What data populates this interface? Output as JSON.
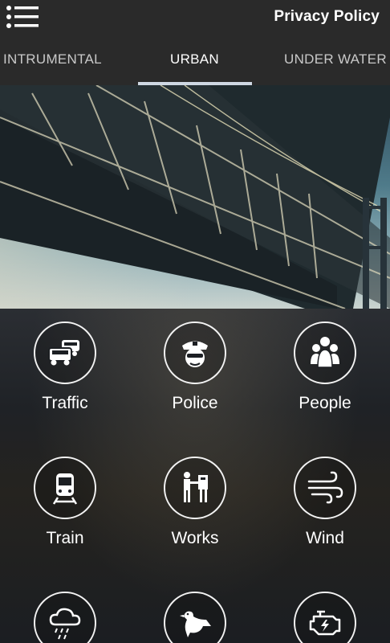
{
  "topbar": {
    "privacy_label": "Privacy Policy",
    "menu_icon": "list-menu-icon"
  },
  "tabs": [
    {
      "label": "INTRUMENTAL",
      "active": false
    },
    {
      "label": "URBAN",
      "active": true
    },
    {
      "label": "UNDER WATER",
      "active": false
    }
  ],
  "hero": {
    "image": "bridge-photo"
  },
  "sounds": [
    {
      "label": "Traffic",
      "icon": "cars-icon"
    },
    {
      "label": "Police",
      "icon": "police-officer-icon"
    },
    {
      "label": "People",
      "icon": "people-group-icon"
    },
    {
      "label": "Train",
      "icon": "train-icon"
    },
    {
      "label": "Works",
      "icon": "construction-worker-icon"
    },
    {
      "label": "Wind",
      "icon": "wind-icon"
    },
    {
      "label": "",
      "icon": "storm-cloud-icon"
    },
    {
      "label": "",
      "icon": "pigeon-icon"
    },
    {
      "label": "",
      "icon": "engine-icon"
    }
  ],
  "colors": {
    "bar": "#2a2a2a",
    "indicator": "#cfd8e3",
    "text": "#ffffff"
  }
}
